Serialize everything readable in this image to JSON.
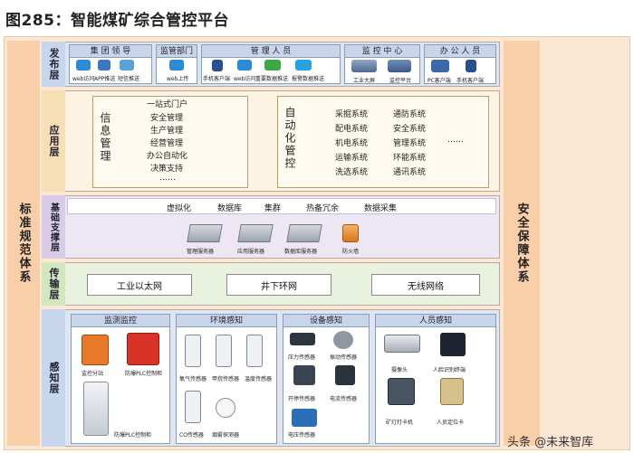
{
  "title": "图285：智能煤矿综合管控平台",
  "left_side": "标准规范体系",
  "right_side": "安全保障体系",
  "layers": {
    "publish": {
      "label": "发布层",
      "groups": [
        {
          "title": "集 团 领 导",
          "items": [
            "web访问",
            "APP推送",
            "短信推送"
          ]
        },
        {
          "title": "监管部门",
          "items": [
            "web上传"
          ]
        },
        {
          "title": "管 理 人 员",
          "items": [
            "手机客户端",
            "web访问",
            "重要数据推送",
            "报警数据推送"
          ]
        },
        {
          "title": "监 控 中 心",
          "items": [
            "工业大屏",
            "监控平台"
          ]
        },
        {
          "title": "办 公 人 员",
          "items": [
            "PC客户端",
            "手机客户端"
          ]
        }
      ]
    },
    "application": {
      "label": "应用层",
      "info_title": "信息管理",
      "info_items": [
        "一站式门户",
        "安全管理",
        "生产管理",
        "经营管理",
        "办公自动化",
        "决策支持",
        "……"
      ],
      "auto_title": "自动化管控",
      "auto_col1": [
        "采掘系统",
        "配电系统",
        "机电系统",
        "运输系统",
        "洗选系统"
      ],
      "auto_col2": [
        "通防系统",
        "安全系统",
        "管理系统",
        "环能系统",
        "通讯系统"
      ],
      "auto_more": "……"
    },
    "support": {
      "label": "基础支撑层",
      "items": [
        "虚拟化",
        "数据库",
        "集群",
        "热备冗余",
        "数据采集"
      ],
      "devices": [
        "管理服务器",
        "应用服务器",
        "数据库服务器",
        "防火墙"
      ]
    },
    "transport": {
      "label": "传输层",
      "items": [
        "工业以太网",
        "井下环网",
        "无线网络"
      ]
    },
    "sensing": {
      "label": "感知层",
      "groups": [
        {
          "title": "监测监控",
          "items": [
            "监控分站",
            "防爆PLC控制柜",
            "防爆PLC控制柜"
          ]
        },
        {
          "title": "环境感知",
          "items": [
            "氧气传感器",
            "甲烷传感器",
            "温度传感器",
            "CO传感器",
            "烟雾探测器"
          ]
        },
        {
          "title": "设备感知",
          "items": [
            "压力传感器",
            "振动传感器",
            "开停传感器",
            "电流传感器",
            "电压传感器"
          ]
        },
        {
          "title": "人员感知",
          "items": [
            "摄像头",
            "人脸识别终端",
            "矿灯打卡机",
            "人员定位卡"
          ]
        }
      ]
    }
  },
  "watermark": "头条 @未来智库"
}
